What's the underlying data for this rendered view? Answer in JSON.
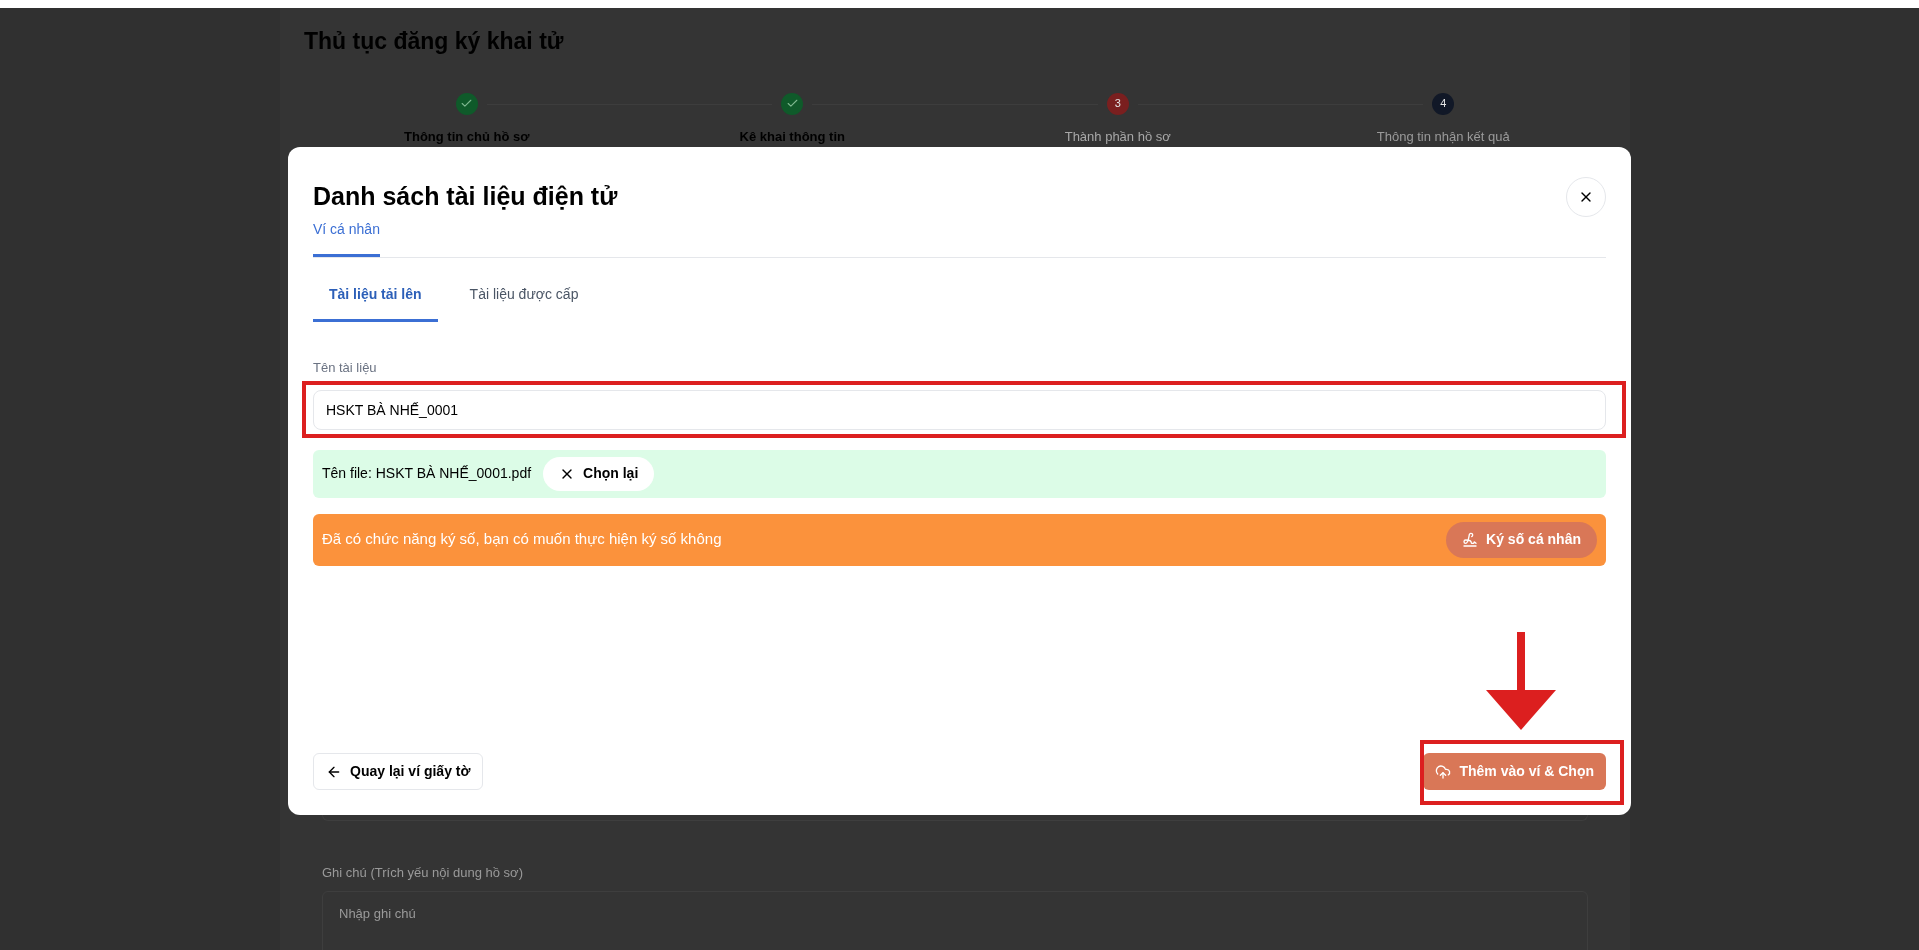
{
  "page": {
    "title": "Thủ tục đăng ký khai tử",
    "steps": [
      {
        "label": "Thông tin chủ hồ sơ",
        "done": true,
        "selected": false
      },
      {
        "label": "Kê khai thông tin",
        "done": true,
        "selected": false
      },
      {
        "label": "Thành phần hồ sơ",
        "done": false,
        "selected": true,
        "number": "3"
      },
      {
        "label": "Thông tin nhận kết quả",
        "done": false,
        "selected": false,
        "number": "4"
      }
    ],
    "notes": {
      "label": "Ghi chú (Trích yếu nội dung hồ sơ)",
      "placeholder": "Nhập ghi chú"
    }
  },
  "modal": {
    "title": "Danh sách tài liệu điện tử",
    "tabs": [
      {
        "label": "Ví cá nhân",
        "selected": true
      }
    ],
    "subtabs": [
      {
        "label": "Tài liệu tải lên",
        "selected": true
      },
      {
        "label": "Tài liệu được cấp",
        "selected": false
      }
    ],
    "field": {
      "label": "Tên tài liệu",
      "value": "HSKT BÀ NHẾ_0001"
    },
    "file": {
      "text": "Tên file: HSKT BÀ NHẾ_0001.pdf",
      "button": "Chọn lại"
    },
    "sign": {
      "text": "Đã có chức năng ký số, bạn có muốn thực hiện ký số không",
      "button": "Ký số cá nhân"
    },
    "back_button": "Quay lại ví giấy tờ",
    "submit_button": "Thêm vào ví & Chọn"
  }
}
